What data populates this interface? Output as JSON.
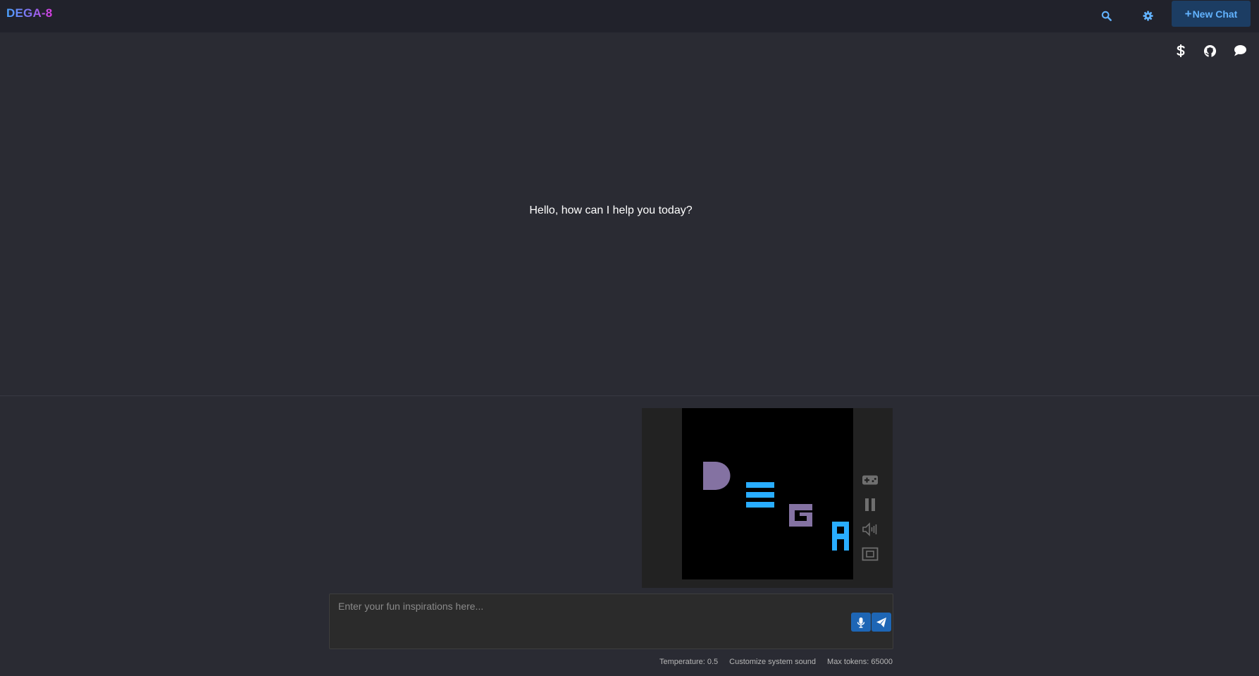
{
  "header": {
    "logo": "DEGA-8",
    "new_chat_plus": "+",
    "new_chat_label": "New Chat"
  },
  "header_icons": [
    "search-icon",
    "gear-icon"
  ],
  "side_icons": [
    "dollar-icon",
    "github-icon",
    "comment-icon"
  ],
  "main": {
    "greeting": "Hello, how can I help you today?"
  },
  "game": {
    "letters": [
      "D",
      "E",
      "G",
      "A"
    ],
    "controls": [
      "gamepad-icon",
      "pause-icon",
      "volume-icon",
      "fullscreen-icon"
    ],
    "colors": {
      "purple": "#8472a2",
      "blue": "#29adff"
    }
  },
  "input": {
    "placeholder": "Enter your fun inspirations here...",
    "value": ""
  },
  "footer": {
    "temperature": "Temperature: 0.5",
    "sound": "Customize system sound",
    "max_tokens": "Max tokens: 65000"
  },
  "colors": {
    "background": "#2a2b33",
    "topbar": "#21222b",
    "accent": "#62b3ff",
    "button": "#1e66b5"
  }
}
